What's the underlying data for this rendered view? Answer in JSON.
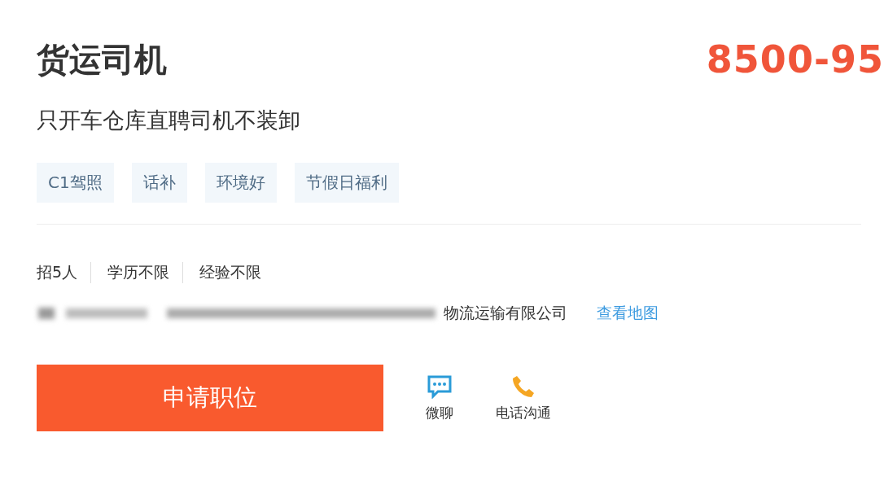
{
  "job": {
    "title": "货运司机",
    "salary": "8500-95",
    "subtitle": "只开车仓库直聘司机不装卸"
  },
  "tags": [
    "C1驾照",
    "话补",
    "环境好",
    "节假日福利"
  ],
  "requirements": [
    "招5人",
    "学历不限",
    "经验不限"
  ],
  "address": {
    "company": "物流运输有限公司",
    "map_link": "查看地图"
  },
  "apply_button": "申请职位",
  "actions": [
    {
      "kind": "chat",
      "label": "微聊"
    },
    {
      "kind": "phone",
      "label": "电话沟通"
    }
  ]
}
